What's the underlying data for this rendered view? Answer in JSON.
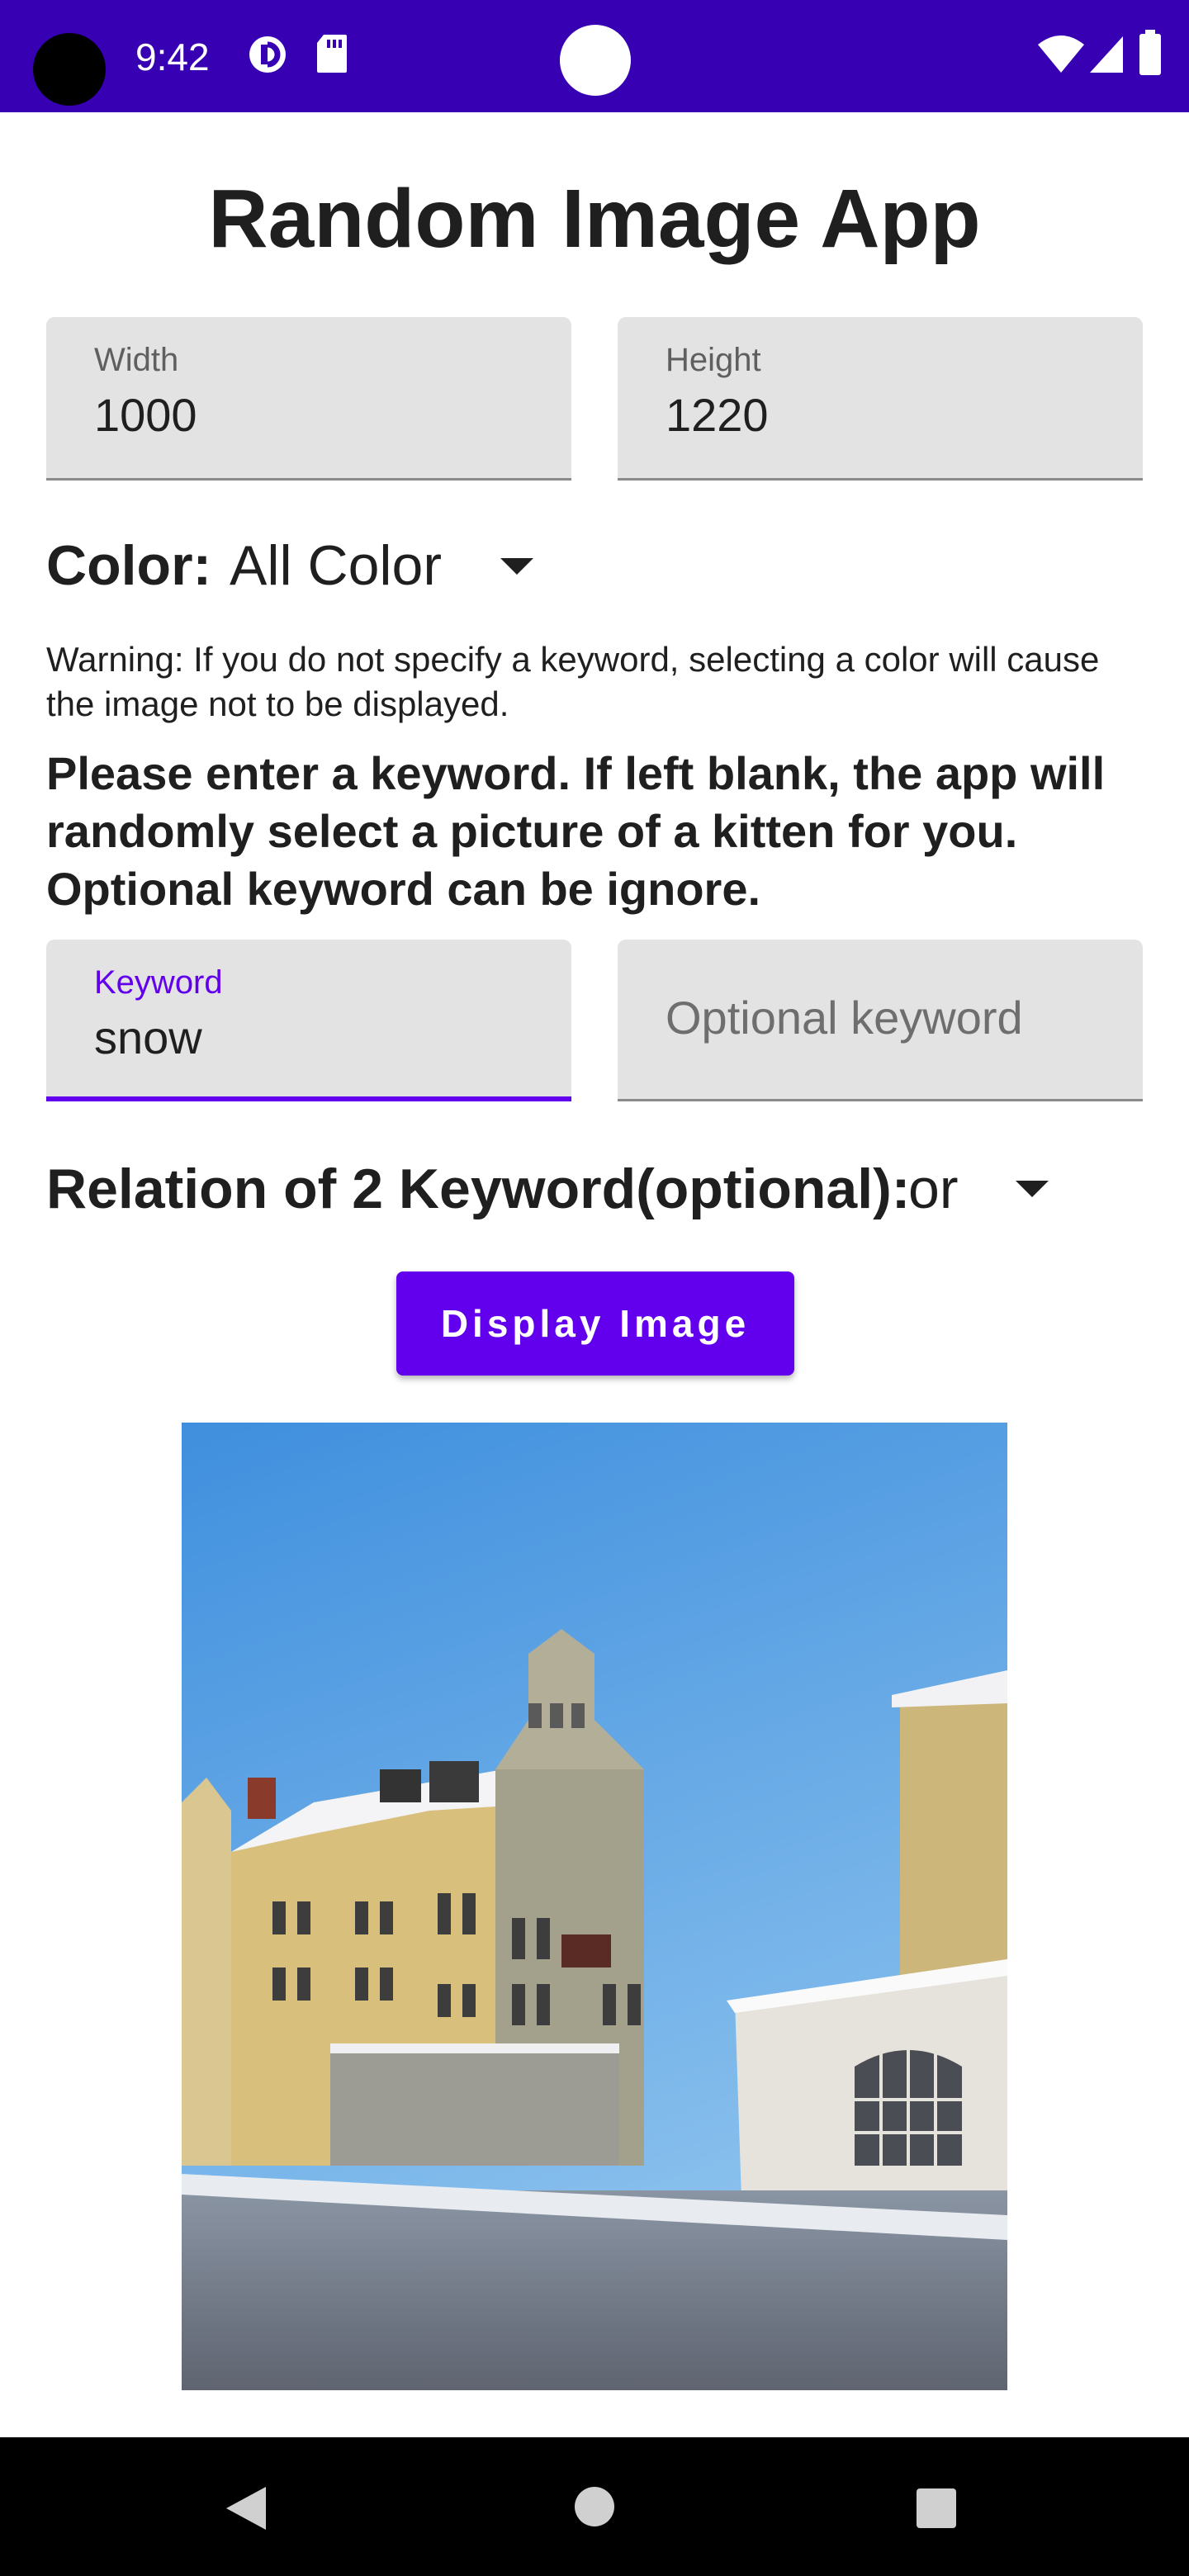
{
  "status_bar": {
    "time": "9:42",
    "icons": [
      "data-saver-icon",
      "sd-card-icon",
      "wifi-icon",
      "signal-icon",
      "battery-icon"
    ]
  },
  "app": {
    "title": "Random Image App"
  },
  "size": {
    "width_label": "Width",
    "width_value": "1000",
    "height_label": "Height",
    "height_value": "1220"
  },
  "color": {
    "label": "Color:",
    "selected": "All Color"
  },
  "warning": "Warning: If you do not specify a keyword, selecting a color will cause the image not to be displayed.",
  "instruction": "Please enter a keyword. If left blank, the app will randomly select a picture of a kitten for you. Optional keyword can be ignore.",
  "keywords": {
    "keyword_label": "Keyword",
    "keyword_value": "snow",
    "optional_placeholder": "Optional keyword"
  },
  "relation": {
    "label": "Relation of 2 Keyword(optional):",
    "selected": "or"
  },
  "display_button": "Display Image",
  "colors": {
    "status_bar": "#3700b3",
    "accent": "#6200ee",
    "field_background": "#e3e3e3"
  },
  "nav_bar": {
    "icons": [
      "back-icon",
      "home-icon",
      "recents-icon"
    ]
  }
}
